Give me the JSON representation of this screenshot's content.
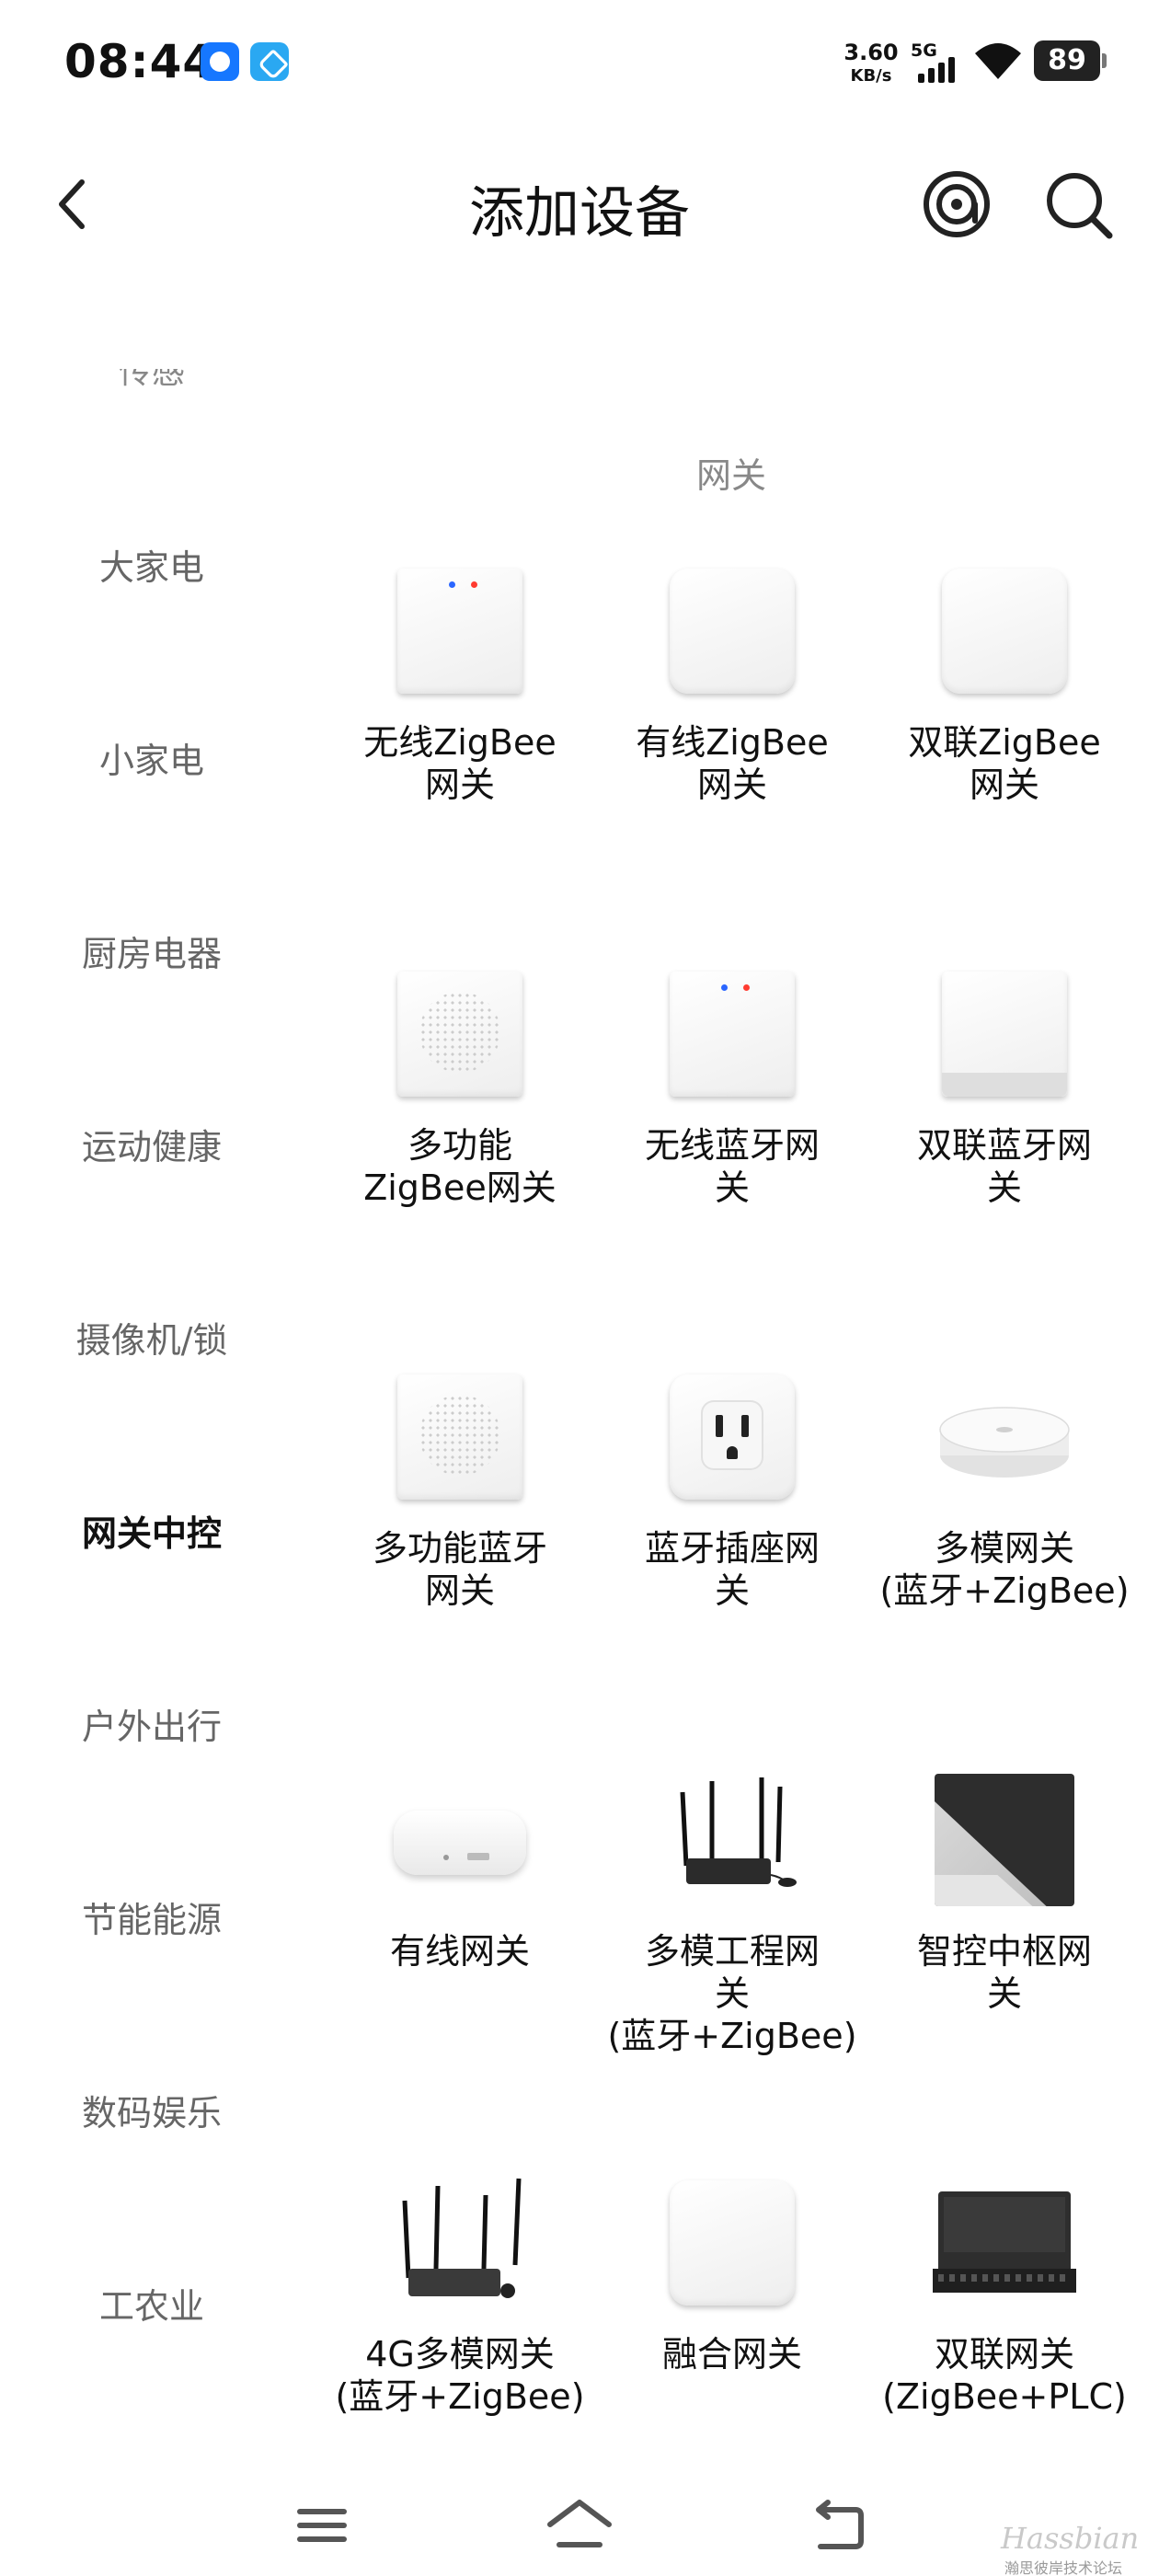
{
  "status_bar": {
    "time": "08:44",
    "net_speed_value": "3.60",
    "net_speed_unit": "KB/s",
    "signal_label": "5G",
    "battery": "89",
    "icons": [
      "app-notification-icon-blue",
      "app-notification-icon-cyan",
      "cellular-signal-icon",
      "wifi-icon",
      "battery-icon"
    ]
  },
  "header": {
    "title": "添加设备",
    "back_icon": "back-arrow-icon",
    "scan_icon": "scan-nearby-icon",
    "search_icon": "search-icon"
  },
  "sidebar": {
    "partial_top": "传感",
    "items": [
      {
        "label": "大家电"
      },
      {
        "label": "小家电"
      },
      {
        "label": "厨房电器"
      },
      {
        "label": "运动健康"
      },
      {
        "label": "摄像机/锁"
      },
      {
        "label": "网关中控",
        "active": true
      },
      {
        "label": "户外出行"
      },
      {
        "label": "节能能源"
      },
      {
        "label": "数码娱乐"
      },
      {
        "label": "工农业"
      }
    ]
  },
  "section": {
    "title": "网关"
  },
  "devices": [
    {
      "name": "无线ZigBee\n网关",
      "icon": "white-square-hub-with-leds"
    },
    {
      "name": "有线ZigBee\n网关",
      "icon": "white-rounded-hub"
    },
    {
      "name": "双联ZigBee\n网关",
      "icon": "white-rounded-hub"
    },
    {
      "name": "多功能\nZigBee网关",
      "icon": "white-hub-with-speaker-mesh"
    },
    {
      "name": "无线蓝牙网\n关",
      "icon": "white-square-hub-with-leds"
    },
    {
      "name": "双联蓝牙网\n关",
      "icon": "white-hub-on-stand"
    },
    {
      "name": "多功能蓝牙\n网关",
      "icon": "white-hub-with-speaker-mesh"
    },
    {
      "name": "蓝牙插座网\n关",
      "icon": "wall-socket-plug"
    },
    {
      "name": "多模网关\n(蓝牙+ZigBee)",
      "icon": "round-puck-gateway"
    },
    {
      "name": "有线网关",
      "icon": "flat-white-gateway"
    },
    {
      "name": "多模工程网\n关\n(蓝牙+ZigBee)",
      "icon": "router-with-antennas"
    },
    {
      "name": "智控中枢网\n关",
      "icon": "dark-control-panel"
    },
    {
      "name": "4G多模网关\n(蓝牙+ZigBee)",
      "icon": "router-with-four-antennas"
    },
    {
      "name": "融合网关",
      "icon": "white-rounded-hub"
    },
    {
      "name": "双联网关\n(ZigBee+PLC)",
      "icon": "black-din-rail-module"
    }
  ],
  "bottom_nav": {
    "icons": [
      "menu-icon",
      "home-icon",
      "back-nav-icon"
    ]
  },
  "watermark": {
    "main": "Hassbian",
    "sub": "瀚思彼岸技术论坛"
  }
}
